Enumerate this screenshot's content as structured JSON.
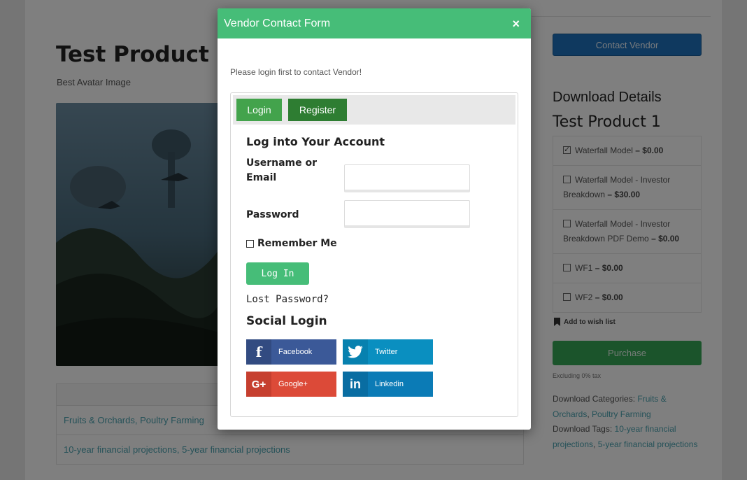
{
  "page": {
    "product_title": "Test Product 1",
    "product_subtitle": "Best Avatar Image",
    "info_rows": {
      "categories": [
        "Fruits & Orchards",
        "Poultry Farming"
      ],
      "tags": [
        "10-year financial projections",
        "5-year financial projections"
      ]
    }
  },
  "sidebar": {
    "contact_vendor_label": "Contact Vendor",
    "download_details_heading": "Download Details",
    "product_name": "Test Product 1",
    "price_options": [
      {
        "name": "Waterfall Model",
        "price": "– $0.00",
        "checked": true
      },
      {
        "name": "Waterfall Model - Investor Breakdown",
        "price": "– $30.00",
        "checked": false
      },
      {
        "name": "Waterfall Model - Investor Breakdown PDF Demo",
        "price": "– $0.00",
        "checked": false
      },
      {
        "name": "WF1",
        "price": "– $0.00",
        "checked": false
      },
      {
        "name": "WF2",
        "price": "– $0.00",
        "checked": false
      }
    ],
    "wishlist_label": "Add to wish list",
    "purchase_label": "Purchase",
    "tax_note": "Excluding 0% tax",
    "categories_label": "Download Categories:",
    "categories": [
      "Fruits & Orchards",
      "Poultry Farming"
    ],
    "tags_label": "Download Tags:",
    "tags": [
      "10-year financial projections",
      "5-year financial projections"
    ]
  },
  "modal": {
    "title": "Vendor Contact Form",
    "close_icon": "×",
    "login_note": "Please login first to contact Vendor!",
    "tabs": {
      "login": "Login",
      "register": "Register"
    },
    "form_heading": "Log into Your Account",
    "username_label": "Username or Email",
    "username_value": "",
    "password_label": "Password",
    "password_value": "",
    "remember_label": "Remember Me",
    "login_button": "Log In",
    "lost_password": "Lost Password?",
    "social_heading": "Social Login",
    "social": {
      "facebook": "Facebook",
      "twitter": "Twitter",
      "google": "Google+",
      "linkedin": "Linkedin"
    }
  },
  "colors": {
    "modal_header": "#46bd78",
    "tab_login": "#43a34c",
    "tab_register": "#2e7d32",
    "facebook": "#3b5998",
    "twitter": "#0a8fc0",
    "google": "#dc4a38",
    "linkedin": "#0b7bb6",
    "contact_vendor": "#1e73be",
    "purchase": "#36a957",
    "link": "#4aa3b1"
  }
}
